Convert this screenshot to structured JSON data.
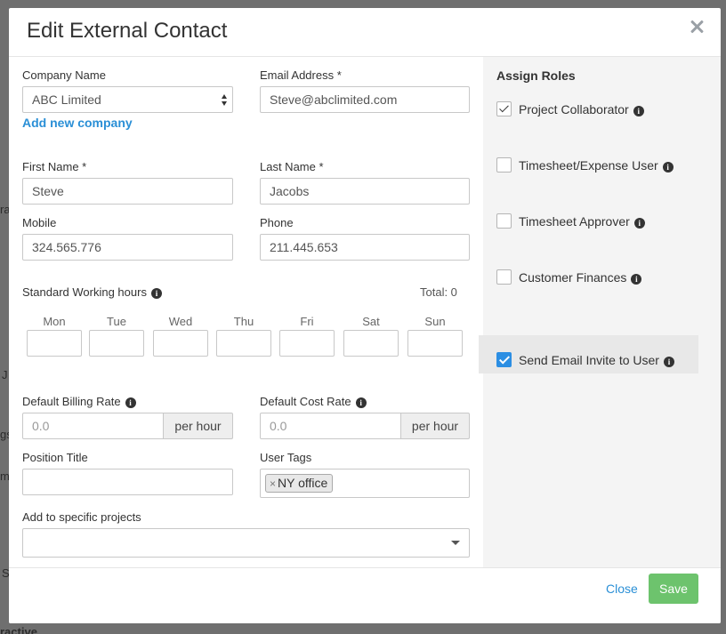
{
  "background": {
    "fragments": [
      "ra",
      "J",
      "gs",
      "m",
      "S",
      "ractive"
    ]
  },
  "dialog": {
    "title": "Edit External Contact",
    "company_name_label": "Company Name",
    "company_name_value": "ABC Limited",
    "add_company_link": "Add new company",
    "email_label": "Email Address *",
    "email_value": "Steve@abclimited.com",
    "first_name_label": "First Name *",
    "first_name_value": "Steve",
    "last_name_label": "Last Name *",
    "last_name_value": "Jacobs",
    "mobile_label": "Mobile",
    "mobile_value": "324.565.776",
    "phone_label": "Phone",
    "phone_value": "211.445.653",
    "working_hours_label": "Standard Working hours",
    "working_hours_total": "Total: 0",
    "days": [
      "Mon",
      "Tue",
      "Wed",
      "Thu",
      "Fri",
      "Sat",
      "Sun"
    ],
    "billing_rate_label": "Default Billing Rate",
    "billing_rate_placeholder": "0.0",
    "cost_rate_label": "Default Cost Rate",
    "cost_rate_placeholder": "0.0",
    "per_hour": "per hour",
    "position_title_label": "Position Title",
    "position_title_value": "",
    "user_tags_label": "User Tags",
    "user_tags": [
      "NY office"
    ],
    "tag_remove_glyph": "×",
    "projects_label": "Add to specific projects"
  },
  "roles": {
    "heading": "Assign Roles",
    "items": [
      {
        "label": "Project Collaborator",
        "checked": true
      },
      {
        "label": "Timesheet/Expense User",
        "checked": false
      },
      {
        "label": "Timesheet Approver",
        "checked": false
      },
      {
        "label": "Customer Finances",
        "checked": false
      }
    ],
    "send_invite_label": "Send Email Invite to User",
    "send_invite_checked": true
  },
  "footer": {
    "close_label": "Close",
    "save_label": "Save"
  },
  "colors": {
    "link": "#2a8fd6",
    "save_button": "#6dc36d",
    "checkbox_checked": "#2b8ee3"
  },
  "icons": {
    "info": "i"
  }
}
